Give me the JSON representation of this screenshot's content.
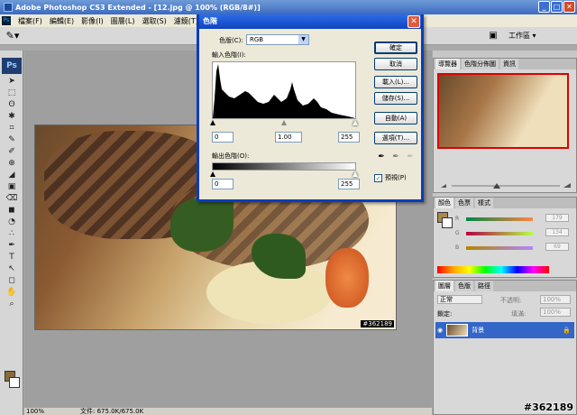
{
  "app": {
    "title": "Adobe Photoshop CS3 Extended - [12.jpg @ 100% (RGB/8#)]",
    "window_buttons": [
      "_",
      "□",
      "✕"
    ]
  },
  "menubar": {
    "items": [
      "檔案(F)",
      "編輯(E)",
      "影像(I)",
      "圖層(L)",
      "選取(S)",
      "濾鏡(T)",
      "分析"
    ]
  },
  "options": {
    "workspace_label": "工作區 ▾"
  },
  "toolbox": {
    "logo": "Ps",
    "tools": [
      "➤",
      "⬚",
      "ʘ",
      "✱",
      "⌗",
      "✎",
      "✐",
      "⊕",
      "◢",
      "▣",
      "⌫",
      "◼",
      "◔",
      "∴",
      "✒",
      "T",
      "↖",
      "◻",
      "✋",
      "⌕"
    ]
  },
  "document": {
    "zoom": "100%",
    "file_size": "文件: 675.0K/675.0K",
    "image_stamp": "#362189"
  },
  "levels_dialog": {
    "title": "色階",
    "channel_label": "色版(C):",
    "channel_value": "RGB",
    "input_label": "輸入色階(I):",
    "input_black": "0",
    "input_gamma": "1.00",
    "input_white": "255",
    "output_label": "輸出色階(O):",
    "output_black": "0",
    "output_white": "255",
    "buttons": {
      "ok": "確定",
      "cancel": "取消",
      "load": "載入(L)...",
      "save": "儲存(S)...",
      "auto": "自動(A)",
      "options": "選項(T)..."
    },
    "preview_label": "預視(P)",
    "preview_checked": true
  },
  "panels": {
    "navigator_tabs": [
      "導覽器",
      "色階分佈圖",
      "資訊"
    ],
    "color_tabs": [
      "顏色",
      "色票",
      "樣式"
    ],
    "color_values": {
      "r": "179",
      "g": "134",
      "b": "69"
    },
    "color_channel_labels": {
      "r": "R",
      "g": "G",
      "b": "B"
    },
    "layers_tabs": [
      "圖層",
      "色版",
      "路徑"
    ],
    "blend_mode": "正常",
    "opacity_label": "不透明:",
    "opacity_value": "100%",
    "lock_label": "鎖定:",
    "fill_label": "填滿:",
    "fill_value": "100%",
    "layer_name": "背景"
  },
  "watermark": "#362189",
  "colors": {
    "titlebar_blue": "#3b6bc1",
    "dialog_border": "#0a3cbf",
    "layer_selected": "#3466c7"
  }
}
